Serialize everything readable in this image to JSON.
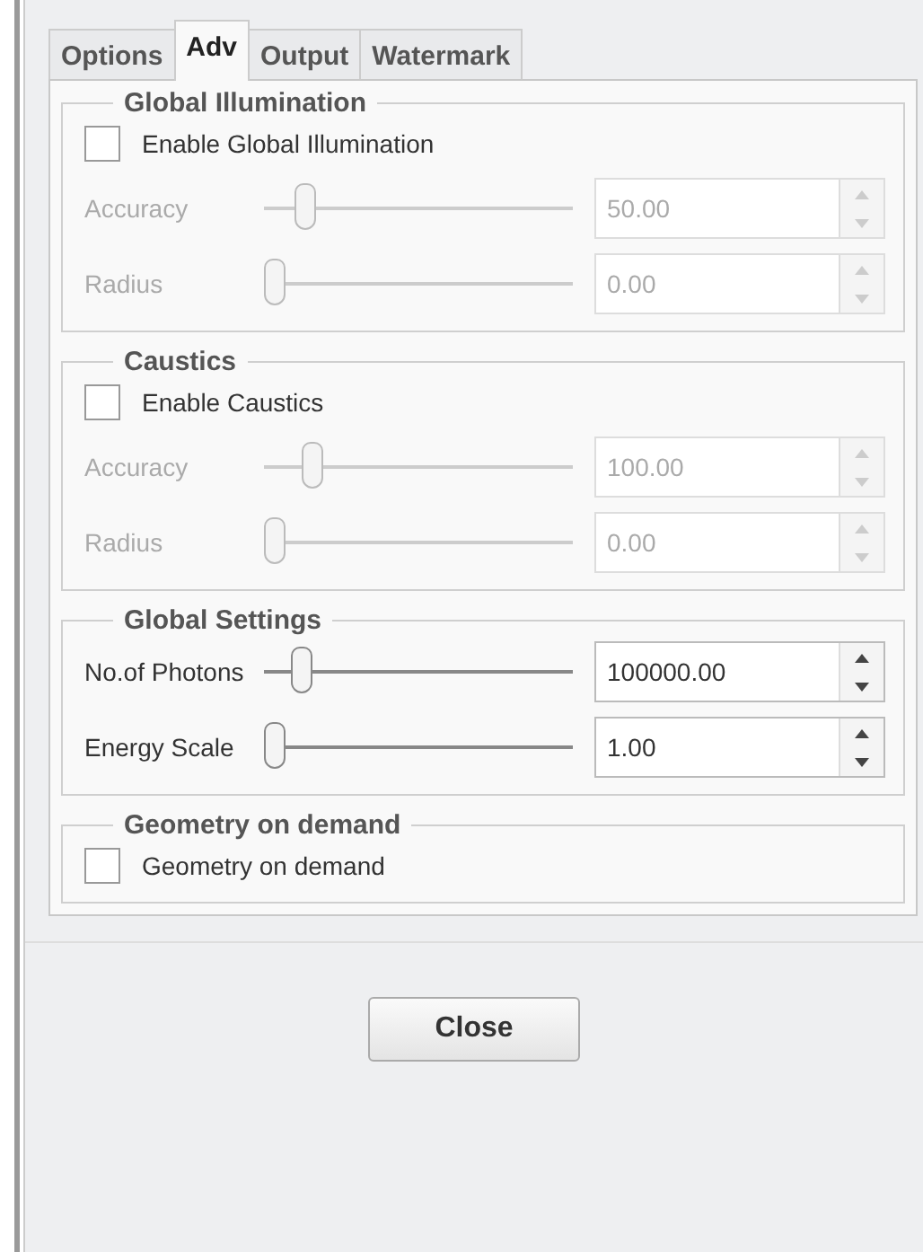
{
  "tabs": [
    {
      "label": "Options",
      "selected": false
    },
    {
      "label": "Adv",
      "selected": true
    },
    {
      "label": "Output",
      "selected": false
    },
    {
      "label": "Watermark",
      "selected": false
    }
  ],
  "groups": [
    {
      "title": "Global Illumination",
      "checkbox": {
        "label": "Enable Global Illumination",
        "checked": false
      },
      "rows": [
        {
          "label": "Accuracy",
          "level": 0.1,
          "value": "50.00",
          "disabled": true
        },
        {
          "label": "Radius",
          "level": 0,
          "value": "0.00",
          "disabled": true
        }
      ]
    },
    {
      "title": "Caustics",
      "checkbox": {
        "label": "Enable Caustics",
        "checked": false
      },
      "rows": [
        {
          "label": "Accuracy",
          "level": 0.12,
          "value": "100.00",
          "disabled": true
        },
        {
          "label": "Radius",
          "level": 0,
          "value": "0.00",
          "disabled": true
        }
      ]
    },
    {
      "title": "Global Settings",
      "rows": [
        {
          "label": "No.of Photons",
          "level": 0.09,
          "value": "100000.00",
          "disabled": false
        },
        {
          "label": "Energy Scale",
          "level": 0,
          "value": "1.00",
          "disabled": false
        }
      ]
    },
    {
      "title": "Geometry on demand",
      "checkbox": {
        "label": "Geometry on demand",
        "checked": false
      }
    }
  ],
  "close_button": "Close"
}
